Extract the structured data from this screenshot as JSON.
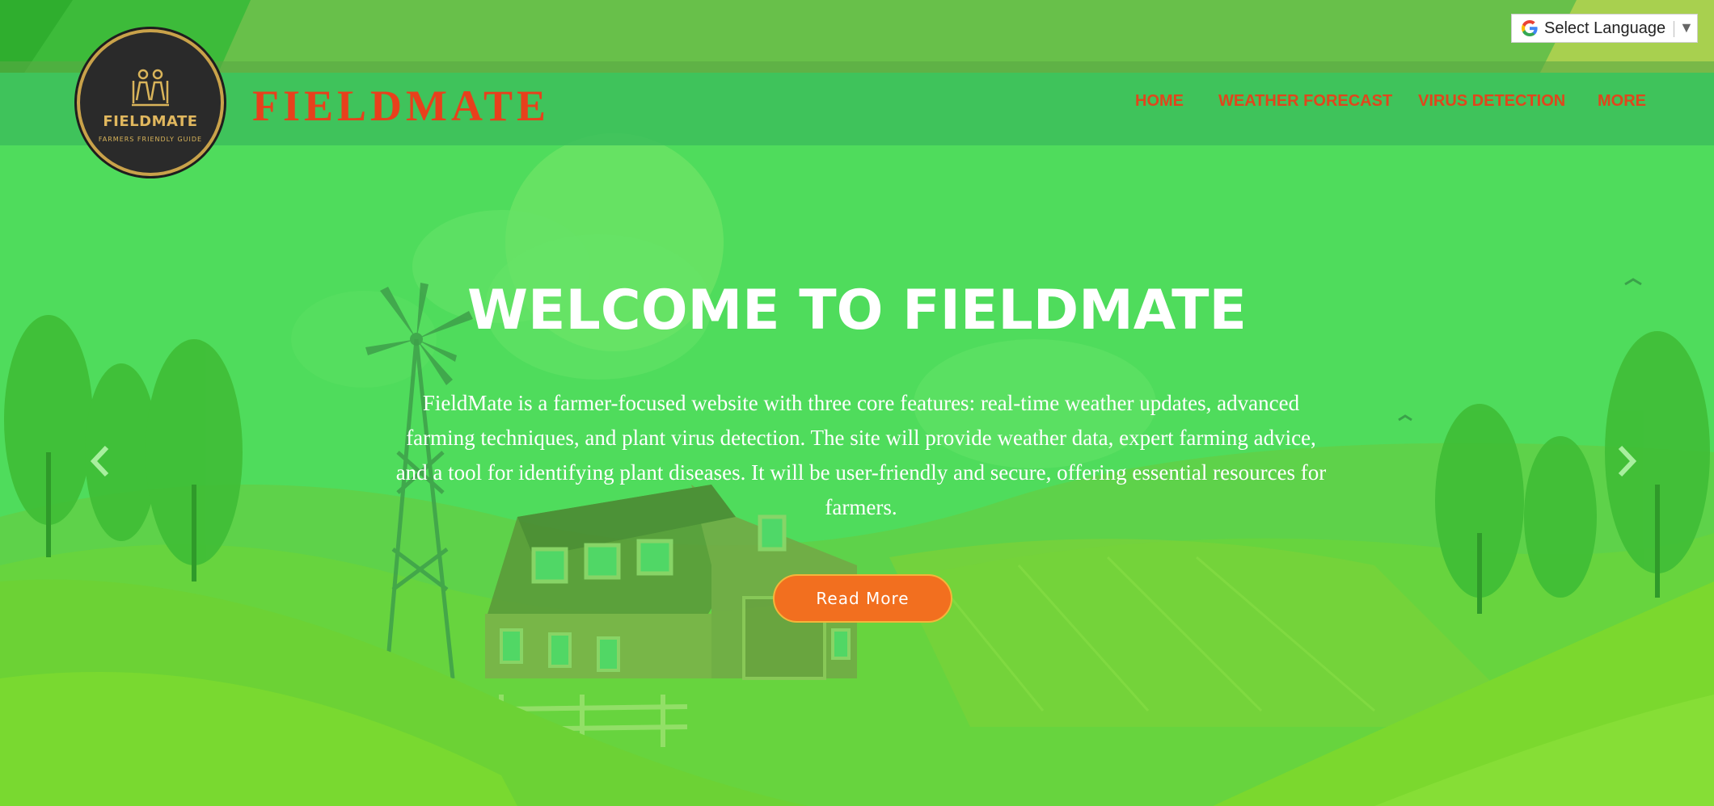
{
  "colors": {
    "brand": "#e8401c",
    "nav_link": "#e0461c",
    "hero_bg": "#52d95a",
    "button": "#f26f1f",
    "logo_gold": "#c9a24a"
  },
  "language_selector": {
    "icon": "google-g-icon",
    "label": "Select Language",
    "arrow": "▼"
  },
  "logo": {
    "name": "FIELDMATE",
    "tagline": "FARMERS FRIENDLY GUIDE"
  },
  "brand": {
    "title": "FIELDMATE"
  },
  "nav": {
    "items": [
      {
        "label": "HOME"
      },
      {
        "label": "WEATHER FORECAST"
      },
      {
        "label": "VIRUS DETECTION"
      },
      {
        "label": "MORE"
      }
    ]
  },
  "hero": {
    "title": "WELCOME TO FIELDMATE",
    "text": "FieldMate is a farmer-focused website with three core features: real-time weather updates, advanced farming techniques, and plant virus detection. The site will provide weather data, expert farming advice, and a tool for identifying plant diseases. It will be user-friendly and secure, offering essential resources for farmers.",
    "button_label": "Read More",
    "prev_icon": "chevron-left-icon",
    "next_icon": "chevron-right-icon"
  }
}
